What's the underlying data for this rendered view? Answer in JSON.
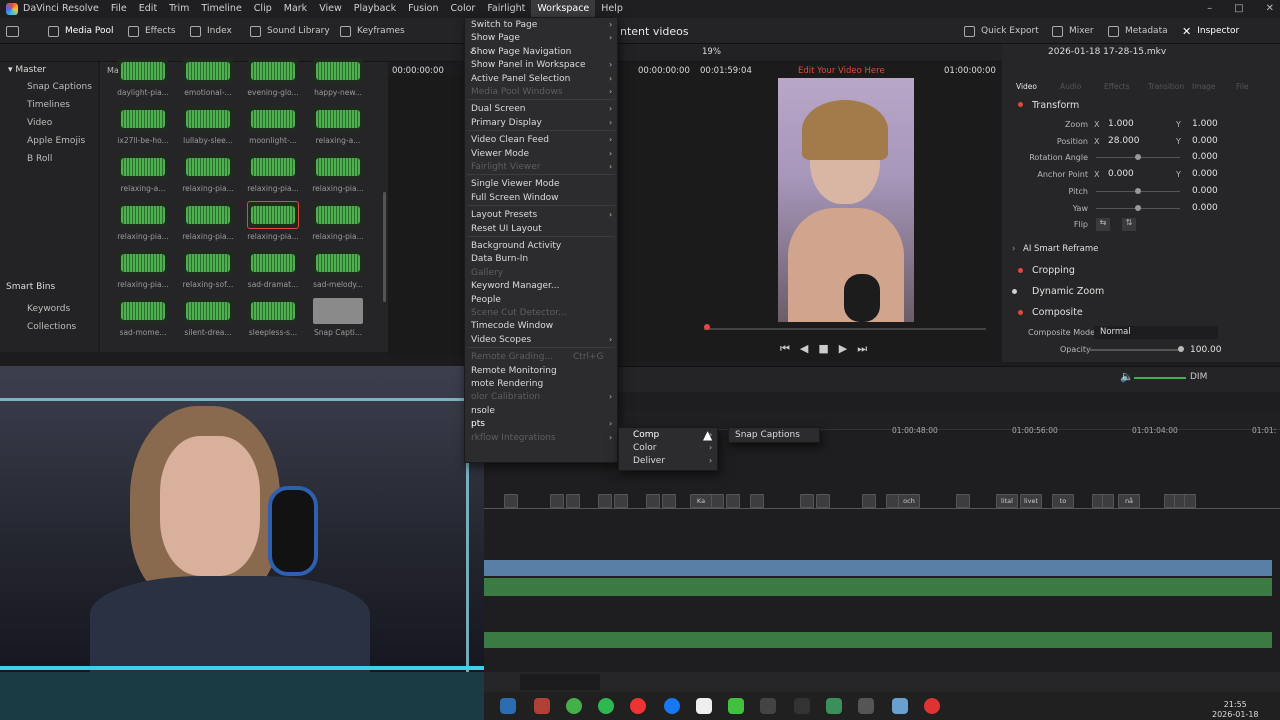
{
  "app": {
    "name": "DaVinci Resolve"
  },
  "menubar": [
    "File",
    "Edit",
    "Trim",
    "Timeline",
    "Clip",
    "Mark",
    "View",
    "Playback",
    "Fusion",
    "Color",
    "Fairlight",
    "Workspace",
    "Help"
  ],
  "toolbar": {
    "media_pool": "Media Pool",
    "effects": "Effects",
    "index": "Index",
    "sound_library": "Sound Library",
    "keyframes": "Keyframes",
    "title_partial": "ntent videos",
    "quick_export": "Quick Export",
    "mixer": "Mixer",
    "metadata": "Metadata",
    "inspector": "Inspector"
  },
  "media_pool": {
    "root": "Master",
    "path": "Master",
    "bins": [
      "Snap Captions",
      "Timelines",
      "Video",
      "Apple Emojis",
      "B Roll"
    ],
    "smart_bins": "Smart Bins",
    "smart_bin_items": [
      "Keywords",
      "Collections"
    ],
    "clips": [
      {
        "label": "daylight-pia..."
      },
      {
        "label": "emotional-..."
      },
      {
        "label": "evening-glo..."
      },
      {
        "label": "happy-new..."
      },
      {
        "label": "ix27ll-be-ho..."
      },
      {
        "label": "lullaby-slee..."
      },
      {
        "label": "moonlight-..."
      },
      {
        "label": "relaxing-a..."
      },
      {
        "label": "relaxing-a..."
      },
      {
        "label": "relaxing-pia..."
      },
      {
        "label": "relaxing-pia..."
      },
      {
        "label": "relaxing-pia..."
      },
      {
        "label": "relaxing-pia..."
      },
      {
        "label": "relaxing-pia..."
      },
      {
        "label": "relaxing-pia..."
      },
      {
        "label": "relaxing-pia..."
      },
      {
        "label": "relaxing-pia..."
      },
      {
        "label": "relaxing-sof..."
      },
      {
        "label": "sad-dramat..."
      },
      {
        "label": "sad-melody..."
      },
      {
        "label": "sad-mome..."
      },
      {
        "label": "silent-drea..."
      },
      {
        "label": "sleepless-s..."
      },
      {
        "label": "Snap Capti..."
      }
    ]
  },
  "source_viewer": {
    "timecode": "00:00:00:00"
  },
  "workspace_menu": {
    "items": [
      {
        "label": "Switch to Page",
        "arrow": true
      },
      {
        "label": "Show Page",
        "arrow": true
      },
      {
        "label": "Show Page Navigation",
        "check": true
      },
      {
        "label": "Show Panel in Workspace",
        "arrow": true
      },
      {
        "label": "Active Panel Selection",
        "arrow": true
      },
      {
        "label": "Media Pool Windows",
        "arrow": true,
        "disabled": true
      },
      {
        "label": "Dual Screen",
        "arrow": true
      },
      {
        "label": "Primary Display",
        "arrow": true
      },
      {
        "label": "Video Clean Feed",
        "arrow": true
      },
      {
        "label": "Viewer Mode",
        "arrow": true
      },
      {
        "label": "Fairlight Viewer",
        "arrow": true,
        "disabled": true
      },
      {
        "label": "Single Viewer Mode"
      },
      {
        "label": "Full Screen Window"
      },
      {
        "label": "Layout Presets",
        "arrow": true
      },
      {
        "label": "Reset UI Layout"
      },
      {
        "label": "Background Activity"
      },
      {
        "label": "Data Burn-In"
      },
      {
        "label": "Gallery",
        "disabled": true
      },
      {
        "label": "Keyword Manager..."
      },
      {
        "label": "People"
      },
      {
        "label": "Scene Cut Detector...",
        "disabled": true
      },
      {
        "label": "Timecode Window"
      },
      {
        "label": "Video Scopes",
        "arrow": true
      },
      {
        "label": "Remote Grading...",
        "shortcut": "Ctrl+G",
        "disabled": true
      },
      {
        "label": "Remote Monitoring"
      },
      {
        "label": "mote Rendering"
      },
      {
        "label": "olor Calibration",
        "arrow": true,
        "disabled": true
      },
      {
        "label": "nsole"
      },
      {
        "label": "pts",
        "arrow": true,
        "highlight": true
      },
      {
        "label": "rkflow Integrations",
        "arrow": true,
        "disabled": true
      }
    ],
    "scripts_submenu": [
      "Comp",
      "Color",
      "Deliver"
    ],
    "comp_submenu": [
      "Snap Captions"
    ]
  },
  "viewer": {
    "zoom": "19%",
    "tc_left": "00:00:00:00",
    "duration": "00:01:59:04",
    "title": "Edit Your Video Here",
    "tc_right": "01:00:00:00"
  },
  "inspector": {
    "filename": "2026-01-18 17-28-15.mkv",
    "tabs": [
      "Video",
      "Audio",
      "Effects",
      "Transition",
      "Image",
      "File"
    ],
    "transform": "Transform",
    "rows": [
      {
        "label": "Zoom",
        "axis1": "X",
        "v1": "1.000",
        "axis2": "Y",
        "v2": "1.000"
      },
      {
        "label": "Position",
        "axis1": "X",
        "v1": "28.000",
        "axis2": "Y",
        "v2": "0.000"
      },
      {
        "label": "Rotation Angle",
        "v2": "0.000"
      },
      {
        "label": "Anchor Point",
        "axis1": "X",
        "v1": "0.000",
        "axis2": "Y",
        "v2": "0.000"
      },
      {
        "label": "Pitch",
        "v2": "0.000"
      },
      {
        "label": "Yaw",
        "v2": "0.000"
      },
      {
        "label": "Flip"
      }
    ],
    "smart_reframe": "AI Smart Reframe",
    "cropping": "Cropping",
    "dynamic_zoom": "Dynamic Zoom",
    "composite": "Composite",
    "composite_mode_label": "Composite Mode",
    "composite_mode_value": "Normal",
    "opacity_label": "Opacity",
    "opacity_value": "100.00"
  },
  "timeline": {
    "dim": "DIM",
    "ruler": [
      "01:00:48:00",
      "01:00:56:00",
      "01:01:04:00",
      "01:01:"
    ],
    "subtitle_clips": [
      "Ka",
      "och",
      "lital",
      "livet",
      "to",
      "nå"
    ]
  },
  "taskbar": {
    "time": "21:55",
    "date": "2026-01-18"
  }
}
